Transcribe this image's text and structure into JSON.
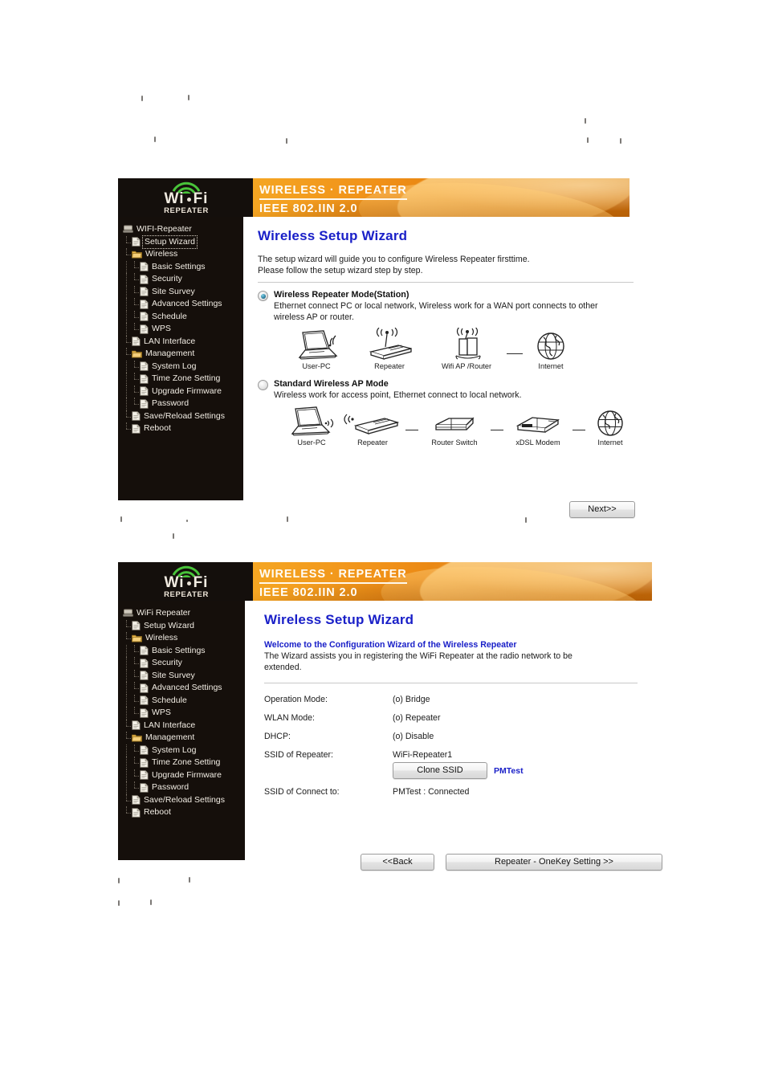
{
  "colors": {
    "banner_orange": "#f09018",
    "sidebar_dark": "#150f0b",
    "heading_blue": "#1a20c8",
    "logo_green": "#49c43a",
    "radio_fill": "#2e7f9e"
  },
  "figure1": {
    "banner": {
      "logo_wifi": "Wi Fi",
      "logo_sub": "REPEATER",
      "title_line1": "WIRELESS · REPEATER",
      "title_line2": "IEEE 802.IIN 2.0"
    },
    "sidebar": {
      "root": "WIFI-Repeater",
      "items": [
        {
          "label": "Setup Wizard",
          "icon": "page-icon",
          "level": 1,
          "selected": true
        },
        {
          "label": "Wireless",
          "icon": "folder-icon",
          "level": 1,
          "selected": false
        },
        {
          "label": "Basic Settings",
          "icon": "page-icon",
          "level": 2,
          "selected": false
        },
        {
          "label": "Security",
          "icon": "page-icon",
          "level": 2,
          "selected": false
        },
        {
          "label": "Site Survey",
          "icon": "page-icon",
          "level": 2,
          "selected": false
        },
        {
          "label": "Advanced Settings",
          "icon": "page-icon",
          "level": 2,
          "selected": false
        },
        {
          "label": "Schedule",
          "icon": "page-icon",
          "level": 2,
          "selected": false
        },
        {
          "label": "WPS",
          "icon": "page-icon",
          "level": 2,
          "selected": false
        },
        {
          "label": "LAN Interface",
          "icon": "page-icon",
          "level": 1,
          "selected": false
        },
        {
          "label": "Management",
          "icon": "folder-icon",
          "level": 1,
          "selected": false
        },
        {
          "label": "System Log",
          "icon": "page-icon",
          "level": 2,
          "selected": false
        },
        {
          "label": "Time Zone Setting",
          "icon": "page-icon",
          "level": 2,
          "selected": false
        },
        {
          "label": "Upgrade Firmware",
          "icon": "page-icon",
          "level": 2,
          "selected": false
        },
        {
          "label": "Password",
          "icon": "page-icon",
          "level": 2,
          "selected": false
        },
        {
          "label": "Save/Reload Settings",
          "icon": "page-icon",
          "level": 1,
          "selected": false
        },
        {
          "label": "Reboot",
          "icon": "page-icon",
          "level": 1,
          "selected": false
        }
      ]
    },
    "main": {
      "title": "Wireless Setup Wizard",
      "intro_line1": "The setup wizard will guide you to configure Wireless Repeater firsttime.",
      "intro_line2": "Please follow the setup wizard step by step.",
      "mode1": {
        "selected": true,
        "title": "Wireless Repeater Mode(Station)",
        "desc_line1": "Ethernet connect PC or local network, Wireless work for a WAN port connects to other",
        "desc_line2": "wireless AP or router.",
        "diagram": [
          {
            "icon": "laptop-icon",
            "caption": "User-PC"
          },
          {
            "icon": "repeater-icon",
            "caption": "Repeater"
          },
          {
            "icon": "ap-router-icon",
            "caption": "Wifi AP /Router"
          },
          {
            "icon": "globe-icon",
            "caption": "Internet"
          }
        ]
      },
      "mode2": {
        "selected": false,
        "title": "Standard Wireless AP Mode",
        "desc_line1": "Wireless work for access point, Ethernet connect to local network.",
        "diagram": [
          {
            "icon": "laptop-icon",
            "caption": "User-PC"
          },
          {
            "icon": "repeater-icon",
            "caption": "Repeater"
          },
          {
            "icon": "switch-icon",
            "caption": "Router Switch"
          },
          {
            "icon": "modem-icon",
            "caption": "xDSL Modem"
          },
          {
            "icon": "globe-icon",
            "caption": "Internet"
          }
        ]
      },
      "next_button": "Next>>"
    }
  },
  "figure2": {
    "banner": {
      "logo_wifi": "Wi Fi",
      "logo_sub": "REPEATER",
      "title_line1": "WIRELESS · REPEATER",
      "title_line2": "IEEE 802.IIN 2.0"
    },
    "sidebar": {
      "root": "WiFi Repeater",
      "items": [
        {
          "label": "Setup Wizard",
          "icon": "page-icon",
          "level": 1,
          "selected": false
        },
        {
          "label": "Wireless",
          "icon": "folder-icon",
          "level": 1,
          "selected": false
        },
        {
          "label": "Basic Settings",
          "icon": "page-icon",
          "level": 2,
          "selected": false
        },
        {
          "label": "Security",
          "icon": "page-icon",
          "level": 2,
          "selected": false
        },
        {
          "label": "Site Survey",
          "icon": "page-icon",
          "level": 2,
          "selected": false
        },
        {
          "label": "Advanced Settings",
          "icon": "page-icon",
          "level": 2,
          "selected": false
        },
        {
          "label": "Schedule",
          "icon": "page-icon",
          "level": 2,
          "selected": false
        },
        {
          "label": "WPS",
          "icon": "page-icon",
          "level": 2,
          "selected": false
        },
        {
          "label": "LAN Interface",
          "icon": "page-icon",
          "level": 1,
          "selected": false
        },
        {
          "label": "Management",
          "icon": "folder-icon",
          "level": 1,
          "selected": false
        },
        {
          "label": "System Log",
          "icon": "page-icon",
          "level": 2,
          "selected": false
        },
        {
          "label": "Time Zone Setting",
          "icon": "page-icon",
          "level": 2,
          "selected": false
        },
        {
          "label": "Upgrade Firmware",
          "icon": "page-icon",
          "level": 2,
          "selected": false
        },
        {
          "label": "Password",
          "icon": "page-icon",
          "level": 2,
          "selected": false
        },
        {
          "label": "Save/Reload Settings",
          "icon": "page-icon",
          "level": 1,
          "selected": false
        },
        {
          "label": "Reboot",
          "icon": "page-icon",
          "level": 1,
          "selected": false
        }
      ]
    },
    "main": {
      "title": "Wireless Setup Wizard",
      "welcome_heading": "Welcome to the Configuration Wizard of the Wireless Repeater",
      "welcome_line1": "The Wizard assists you in registering the WiFi Repeater at the radio network to be",
      "welcome_line2": "extended.",
      "rows": [
        {
          "label": "Operation Mode:",
          "value": "(o) Bridge"
        },
        {
          "label": "WLAN Mode:",
          "value": "(o) Repeater"
        },
        {
          "label": "DHCP:",
          "value": "(o) Disable"
        },
        {
          "label": "SSID of Repeater:",
          "value": "WiFi-Repeater1"
        },
        {
          "label": "SSID of Connect to:",
          "value": "PMTest : Connected"
        }
      ],
      "clone_ssid_button": "Clone SSID",
      "clone_ssid_note": "PMTest",
      "back_button": "<<Back",
      "onekey_button": "Repeater - OneKey Setting >>"
    }
  }
}
